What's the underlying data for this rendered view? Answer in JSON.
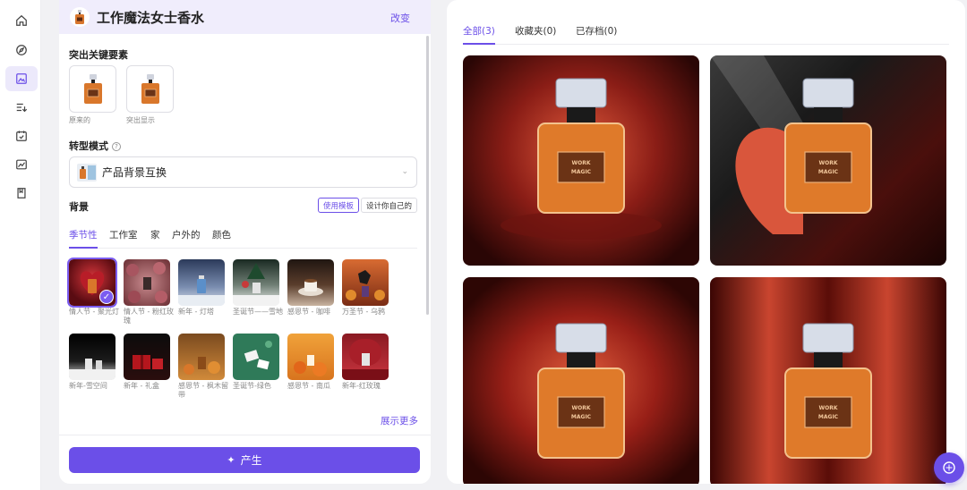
{
  "header": {
    "title": "工作魔法女士香水",
    "change_label": "改变"
  },
  "key_elements": {
    "label": "突出关键要素",
    "items": [
      {
        "caption": "原来的"
      },
      {
        "caption": "突出显示"
      }
    ]
  },
  "mode": {
    "label": "转型模式",
    "help": "?",
    "selected": "产品背景互换"
  },
  "background": {
    "label": "背景",
    "toggle": {
      "template": "使用模板",
      "custom": "设计你自己的"
    },
    "tabs": [
      "季节性",
      "工作室",
      "家",
      "户外的",
      "颜色"
    ],
    "tiles": [
      {
        "caption": "情人节 - 聚光灯",
        "selected": true
      },
      {
        "caption": "情人节 - 粉红玫瑰"
      },
      {
        "caption": "新年 - 灯塔"
      },
      {
        "caption": "圣诞节——雪地"
      },
      {
        "caption": "感恩节 - 咖啡"
      },
      {
        "caption": "万圣节 - 乌鸦"
      },
      {
        "caption": "新年-雪空间"
      },
      {
        "caption": "新年 - 礼盒"
      },
      {
        "caption": "感恩节 - 枫木留带"
      },
      {
        "caption": "圣诞节-绿色"
      },
      {
        "caption": "感恩节 - 南瓜"
      },
      {
        "caption": "新年-红玫瑰"
      }
    ],
    "show_more": "展示更多"
  },
  "generate_label": "产生",
  "gallery": {
    "tabs": [
      "全部(3)",
      "收藏夹(0)",
      "已存档(0)"
    ],
    "label_text": [
      "WORK",
      "MAGIC"
    ]
  },
  "colors": {
    "accent": "#6b4fe8",
    "selected_bg": "#ece9fb"
  }
}
